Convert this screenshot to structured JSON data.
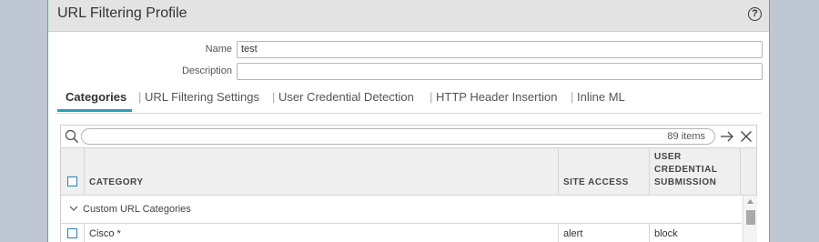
{
  "dialog": {
    "title": "URL Filtering Profile",
    "help_symbol": "?"
  },
  "form": {
    "name_label": "Name",
    "name_value": "test",
    "description_label": "Description",
    "description_value": ""
  },
  "tabs": [
    {
      "label": "Categories",
      "active": true
    },
    {
      "label": "URL Filtering Settings",
      "active": false
    },
    {
      "label": "User Credential Detection",
      "active": false
    },
    {
      "label": "HTTP Header Insertion",
      "active": false
    },
    {
      "label": "Inline ML",
      "active": false
    }
  ],
  "tab_separator": "|",
  "grid": {
    "item_count": "89 items",
    "columns": {
      "category": "CATEGORY",
      "site_access": "SITE ACCESS",
      "user_credential_1": "USER",
      "user_credential_2": "CREDENTIAL",
      "user_credential_3": "SUBMISSION"
    },
    "group_label": "Custom URL Categories",
    "rows": [
      {
        "category": "Cisco *",
        "site_access": "alert",
        "user_credential_submission": "block"
      }
    ]
  },
  "colors": {
    "accent": "#2a9fbc",
    "checkbox": "#2a7fb8",
    "frame": "#34b5cf"
  }
}
